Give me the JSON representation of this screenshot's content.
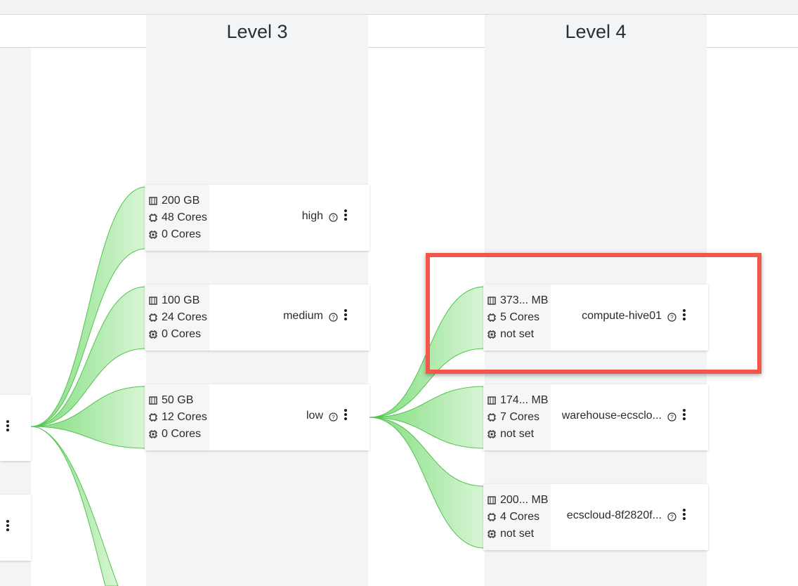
{
  "columns": [
    {
      "title": "Level 3"
    },
    {
      "title": "Level 4"
    }
  ],
  "level3": [
    {
      "memory": "200 GB",
      "cpu": "48 Cores",
      "gpu": "0 Cores",
      "name": "high"
    },
    {
      "memory": "100 GB",
      "cpu": "24 Cores",
      "gpu": "0 Cores",
      "name": "medium"
    },
    {
      "memory": "50 GB",
      "cpu": "12 Cores",
      "gpu": "0 Cores",
      "name": "low"
    }
  ],
  "level4": [
    {
      "memory": "373... MB",
      "cpu": "5 Cores",
      "gpu": "not set",
      "name": "compute-hive01"
    },
    {
      "memory": "174... MB",
      "cpu": "7 Cores",
      "gpu": "not set",
      "name": "warehouse-ecsclo..."
    },
    {
      "memory": "200... MB",
      "cpu": "4 Cores",
      "gpu": "not set",
      "name": "ecscloud-8f2820f..."
    }
  ],
  "icons": {
    "memory": "memory-chip-icon",
    "cpu": "cpu-icon",
    "gpu": "gpu-icon",
    "help": "help-circle-icon",
    "menu": "kebab-menu-icon"
  },
  "colors": {
    "link_fill": "#8ee08a",
    "link_stroke": "#4cc04a",
    "highlight": "#f2574b",
    "column_bg": "#f3f4f6"
  }
}
